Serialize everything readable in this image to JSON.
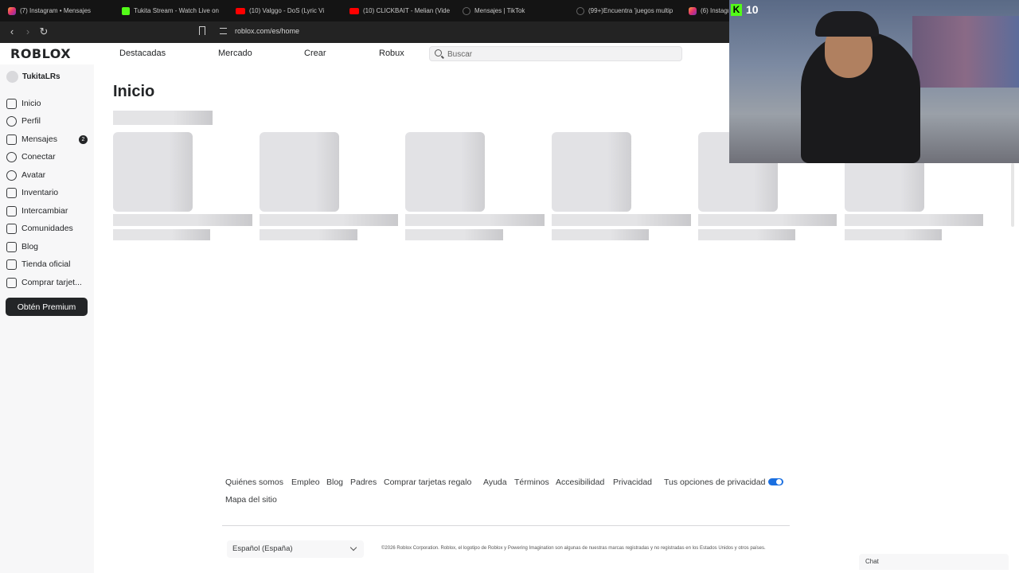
{
  "browser": {
    "tabs": [
      {
        "icon": "instagram-icon",
        "title": "(7) Instagram • Mensajes"
      },
      {
        "icon": "kick-icon",
        "title": "Tukita Stream - Watch Live on"
      },
      {
        "icon": "youtube-icon",
        "title": "(10) Valggo - DoS (Lyric Vi"
      },
      {
        "icon": "youtube-icon",
        "title": "(10) CLICKBAIT - Melian (Vide"
      },
      {
        "icon": "tiktok-icon",
        "title": "Mensajes | TikTok"
      },
      {
        "icon": "tiktok-icon",
        "title": "(99+)Encuentra 'juegos multip"
      },
      {
        "icon": "instagram-icon",
        "title": "(6) Instagr"
      }
    ],
    "url": "roblox.com/es/home"
  },
  "overlay": {
    "kick_letter": "K",
    "viewer_count": "10"
  },
  "header": {
    "logo": "ROBLOX",
    "nav": [
      "Destacadas",
      "Mercado",
      "Crear",
      "Robux"
    ],
    "search_placeholder": "Buscar"
  },
  "sidebar": {
    "username": "TukitaLRs",
    "items": [
      {
        "label": "Inicio",
        "icon": "home-icon"
      },
      {
        "label": "Perfil",
        "icon": "profile-icon"
      },
      {
        "label": "Mensajes",
        "icon": "messages-icon"
      },
      {
        "label": "Conectar",
        "icon": "friends-icon"
      },
      {
        "label": "Avatar",
        "icon": "avatar-icon"
      },
      {
        "label": "Inventario",
        "icon": "inventory-icon"
      },
      {
        "label": "Intercambiar",
        "icon": "trade-icon"
      },
      {
        "label": "Comunidades",
        "icon": "groups-icon"
      },
      {
        "label": "Blog",
        "icon": "blog-icon"
      },
      {
        "label": "Tienda oficial",
        "icon": "shop-icon"
      },
      {
        "label": "Comprar tarjet...",
        "icon": "gift-card-icon"
      }
    ],
    "messages_badge": "2",
    "premium_button": "Obtén Premium"
  },
  "main": {
    "title": "Inicio"
  },
  "footer": {
    "links": [
      "Quiénes somos",
      "Empleo",
      "Blog",
      "Padres",
      "Comprar tarjetas regalo",
      "Ayuda",
      "Términos",
      "Accesibilidad",
      "Privacidad",
      "Tus opciones de privacidad",
      "Mapa del sitio"
    ],
    "language": "Español (España)",
    "legal": "©2026 Roblox Corporation. Roblox, el logotipo de Roblox y Powering Imagination son algunas de nuestras marcas registradas y no registradas en los Estados Unidos y otros países.",
    "chat": "Chat"
  },
  "colors": {
    "accent": "#1a6fe0",
    "kick_green": "#53fc18",
    "dark": "#232527"
  }
}
